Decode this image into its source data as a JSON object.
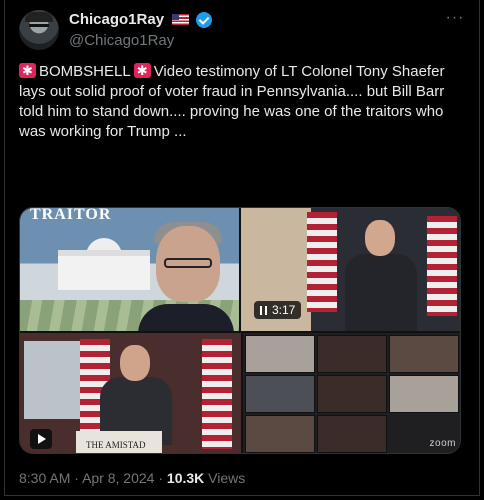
{
  "author": {
    "display_name": "Chicago1Ray",
    "handle": "@Chicago1Ray",
    "verified_color": "#1d9bf0"
  },
  "more_icon": "more-options-icon",
  "tweet": {
    "text_before": "BOMBSHELL",
    "text_after": "Video testimony of LT Colonel Tony Shaefer lays out solid proof of voter fraud in Pennsylvania.... but Bill Barr told him to stand down.... proving he was one of the traitors who was working for Trump ...",
    "icon": "police-light-icon"
  },
  "media": {
    "tile1_banner": "TRAITOR",
    "video_duration": "3:17",
    "podium_text": "THE AMISTAD",
    "zoom_watermark": "zoom"
  },
  "meta": {
    "time": "8:30 AM",
    "separator": "·",
    "date": "Apr 8, 2024",
    "separator2": "·",
    "views_count": "10.3K",
    "views_label": "Views"
  },
  "colors": {
    "background": "#000000",
    "text": "#e7e9ea",
    "secondary_text": "#71767b",
    "border": "#2f3336"
  }
}
